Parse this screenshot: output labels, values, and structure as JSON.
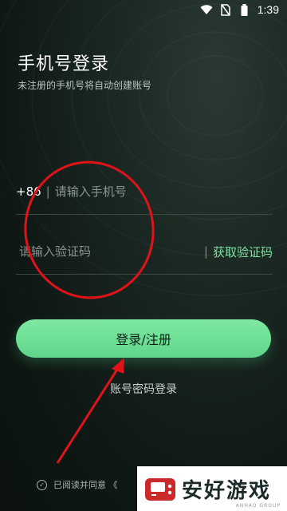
{
  "status_bar": {
    "time": "1:39",
    "icons": [
      "wifi-icon",
      "no-sim-icon",
      "battery-icon"
    ]
  },
  "header": {
    "title": "手机号登录",
    "subtitle": "未注册的手机号将自动创建账号"
  },
  "phone_field": {
    "country_code": "+86",
    "separator": "|",
    "placeholder": "请输入手机号",
    "value": ""
  },
  "code_field": {
    "placeholder": "请输入验证码",
    "value": "",
    "separator": "|",
    "get_code_label": "获取验证码"
  },
  "login_button": {
    "label": "登录/注册"
  },
  "password_login": {
    "label": "账号密码登录"
  },
  "agreement": {
    "text": "已阅读并同意 《"
  },
  "watermark": {
    "text": "安好游戏",
    "subtext": "ANHAO GROUP"
  },
  "colors": {
    "accent": "#6ee096",
    "background": "#101a16",
    "annotation": "#e0121a"
  }
}
